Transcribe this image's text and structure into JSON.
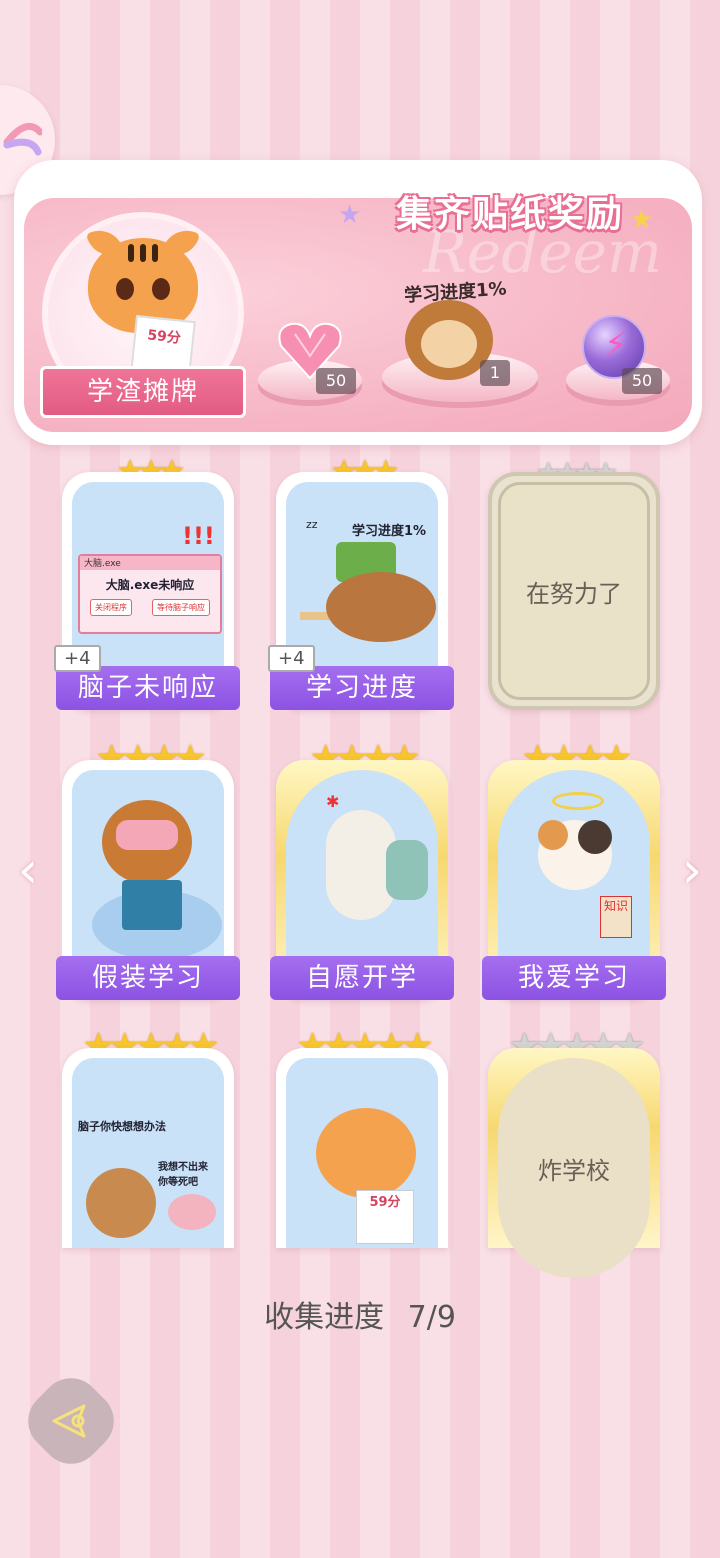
{
  "reward": {
    "title": "集齐贴纸奖励",
    "watermark": "Redeem",
    "featured_name": "学渣摊牌",
    "featured_paper": "59分",
    "progress_label": "学习进度1%",
    "items": [
      {
        "icon": "pink-heart-gem-icon",
        "count": "50"
      },
      {
        "icon": "monkey-sticker-icon",
        "count": "1"
      },
      {
        "icon": "purple-energy-orb-icon",
        "count": "50"
      }
    ]
  },
  "cards": [
    {
      "label": "脑子未响应",
      "bonus": "+4",
      "art": {
        "window_title": "大脑.exe",
        "message": "大脑.exe未响应",
        "button_close": "关闭程序",
        "button_wait": "等待脑子响应",
        "exclaim": "!!!"
      }
    },
    {
      "label": "学习进度",
      "bonus": "+4",
      "art": {
        "caption": "学习进度1%",
        "zz": "zz"
      }
    },
    {
      "label": "在努力了",
      "locked": true
    },
    {
      "label": "假装学习"
    },
    {
      "label": "自愿开学"
    },
    {
      "label": "我爱学习",
      "art": {
        "book": "知识"
      }
    },
    {
      "art": {
        "caption1": "脑子你快想想办法",
        "caption2": "我想不出来 你等死吧"
      }
    },
    {
      "art": {
        "paper": "59分"
      }
    },
    {
      "label": "炸学校",
      "locked": true
    }
  ],
  "footer": {
    "collect_label": "收集进度",
    "collect_value": "7/9"
  },
  "colors": {
    "accent_purple": "#9b62ea",
    "pink": "#f7b9c8",
    "gold": "#f8c52c"
  }
}
